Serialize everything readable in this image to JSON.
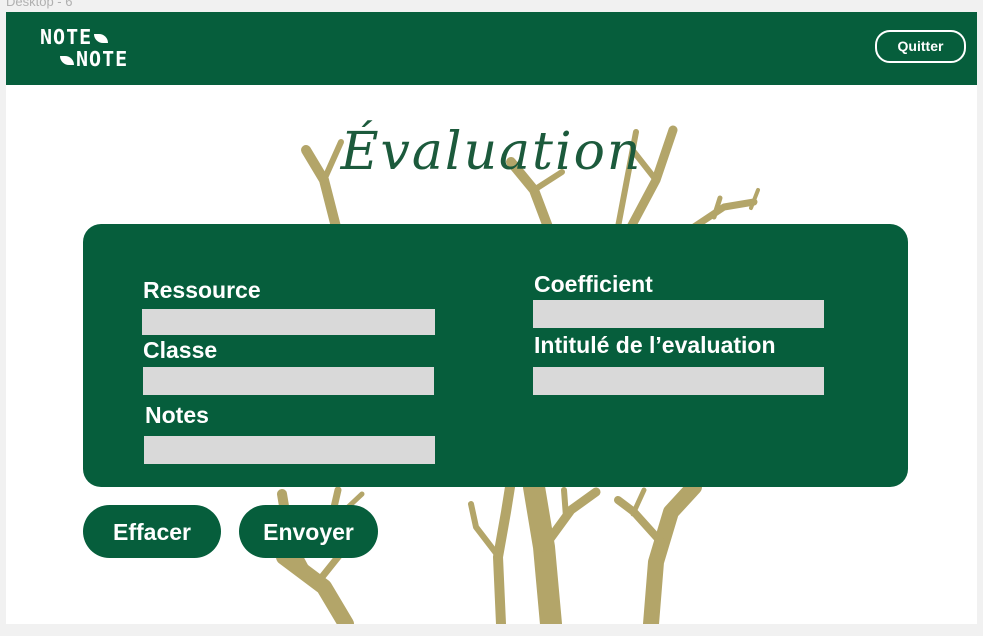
{
  "frame": {
    "label": "Desktop - 6"
  },
  "header": {
    "logo_line1": "NOTE",
    "logo_line2": "NOTE",
    "quit_label": "Quitter"
  },
  "page": {
    "title": "Évaluation"
  },
  "form": {
    "ressource": {
      "label": "Ressource",
      "value": ""
    },
    "classe": {
      "label": "Classe",
      "value": ""
    },
    "notes": {
      "label": "Notes",
      "value": ""
    },
    "coefficient": {
      "label": "Coefficient",
      "value": ""
    },
    "intitule": {
      "label": "Intitulé de l’evaluation",
      "value": ""
    }
  },
  "actions": {
    "clear_label": "Effacer",
    "submit_label": "Envoyer"
  },
  "colors": {
    "brand_green": "#065e3c",
    "title_green": "#1c5a3c",
    "tree_olive": "#b3a569",
    "input_gray": "#d9d9d9"
  },
  "icons": {
    "logo_leaf": "leaf-icon",
    "background": "tree-illustration"
  }
}
